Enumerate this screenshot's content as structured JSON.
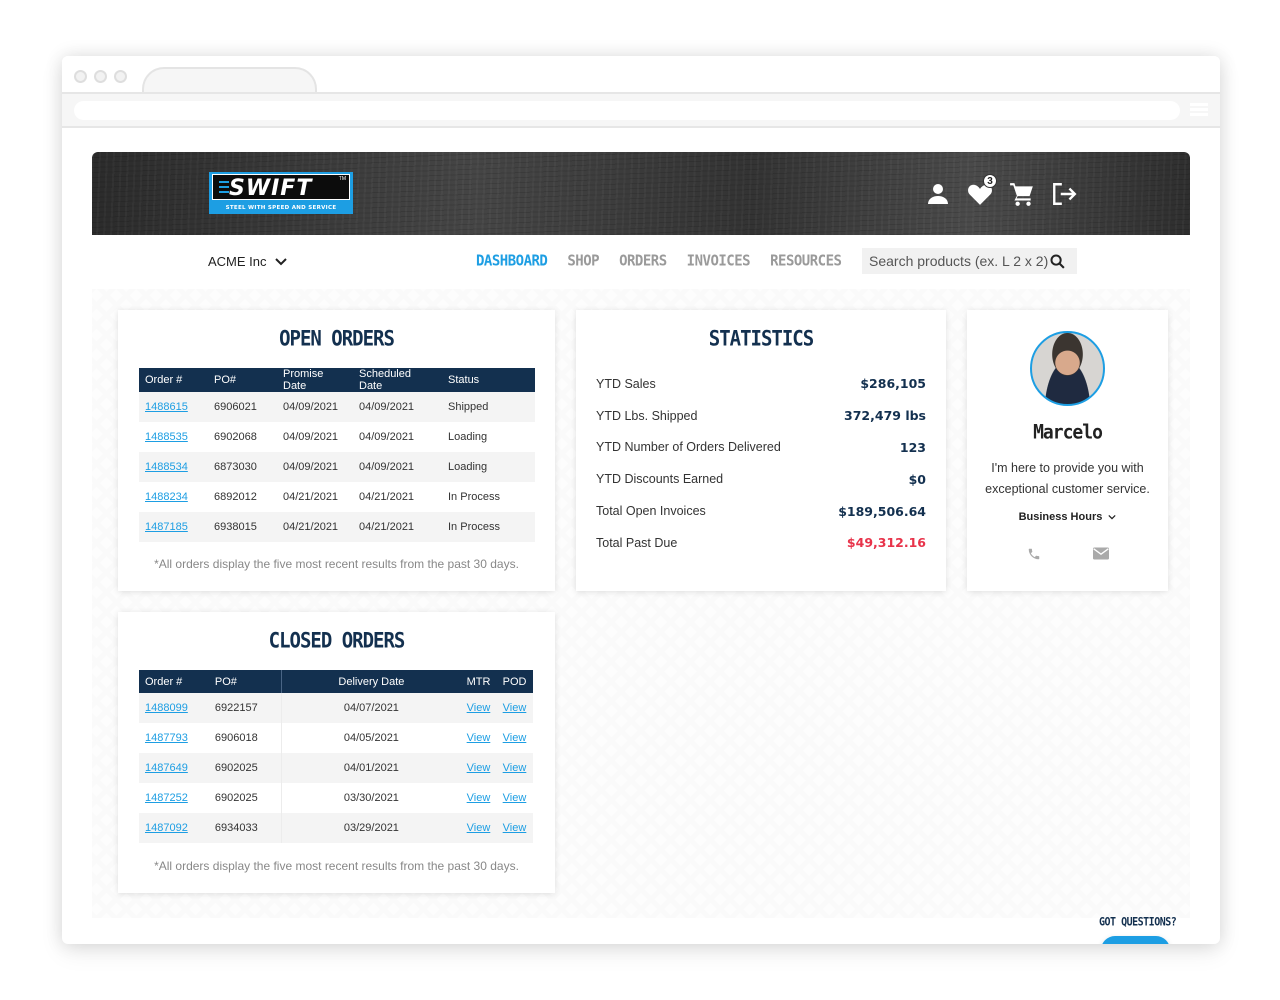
{
  "browser": {
    "window_controls": [
      "close",
      "minimize",
      "maximize"
    ]
  },
  "header": {
    "logo": {
      "word": "SWIFT",
      "tm": "TM",
      "tagline": "STEEL WITH SPEED AND SERVICE"
    },
    "icons": [
      {
        "name": "user-icon"
      },
      {
        "name": "heart-icon",
        "badge": "3"
      },
      {
        "name": "cart-icon"
      },
      {
        "name": "logout-icon"
      }
    ]
  },
  "nav": {
    "account": "ACME Inc",
    "items": [
      {
        "label": "DASHBOARD",
        "active": true
      },
      {
        "label": "SHOP",
        "active": false
      },
      {
        "label": "ORDERS",
        "active": false
      },
      {
        "label": "INVOICES",
        "active": false
      },
      {
        "label": "RESOURCES",
        "active": false
      }
    ],
    "search": {
      "placeholder": "Search products (ex. L 2 x 2)",
      "value": ""
    }
  },
  "open_orders": {
    "title": "OPEN ORDERS",
    "columns": [
      "Order #",
      "PO#",
      "Promise Date",
      "Scheduled Date",
      "Status"
    ],
    "rows": [
      [
        "1488615",
        "6906021",
        "04/09/2021",
        "04/09/2021",
        "Shipped"
      ],
      [
        "1488535",
        "6902068",
        "04/09/2021",
        "04/09/2021",
        "Loading"
      ],
      [
        "1488534",
        "6873030",
        "04/09/2021",
        "04/09/2021",
        "Loading"
      ],
      [
        "1488234",
        "6892012",
        "04/21/2021",
        "04/21/2021",
        "In Process"
      ],
      [
        "1487185",
        "6938015",
        "04/21/2021",
        "04/21/2021",
        "In Process"
      ]
    ],
    "note": "*All orders display the five most recent results from the past 30 days."
  },
  "statistics": {
    "title": "STATISTICS",
    "rows": [
      {
        "label": "YTD Sales",
        "value": "$286,105",
        "alert": false
      },
      {
        "label": "YTD Lbs. Shipped",
        "value": "372,479 lbs",
        "alert": false
      },
      {
        "label": "YTD Number of Orders Delivered",
        "value": "123",
        "alert": false
      },
      {
        "label": "YTD Discounts Earned",
        "value": "$0",
        "alert": false
      },
      {
        "label": "Total Open Invoices",
        "value": "$189,506.64",
        "alert": false
      },
      {
        "label": "Total Past Due",
        "value": "$49,312.16",
        "alert": true
      }
    ]
  },
  "rep": {
    "name": "Marcelo",
    "message": "I'm here to provide you with exceptional customer service.",
    "hours_label": "Business Hours"
  },
  "closed_orders": {
    "title": "CLOSED ORDERS",
    "columns": [
      "Order #",
      "PO#",
      "Delivery Date",
      "MTR",
      "POD"
    ],
    "rows": [
      [
        "1488099",
        "6922157",
        "04/07/2021",
        "View",
        "View"
      ],
      [
        "1487793",
        "6906018",
        "04/05/2021",
        "View",
        "View"
      ],
      [
        "1487649",
        "6902025",
        "04/01/2021",
        "View",
        "View"
      ],
      [
        "1487252",
        "6902025",
        "03/30/2021",
        "View",
        "View"
      ],
      [
        "1487092",
        "6934033",
        "03/29/2021",
        "View",
        "View"
      ]
    ],
    "note": "*All orders display the five most recent results from the past 30 days."
  },
  "chat": {
    "label": "GOT QUESTIONS?"
  },
  "colors": {
    "brand_blue": "#1d9ee3",
    "navy": "#13304f",
    "alert_red": "#e8334a"
  }
}
